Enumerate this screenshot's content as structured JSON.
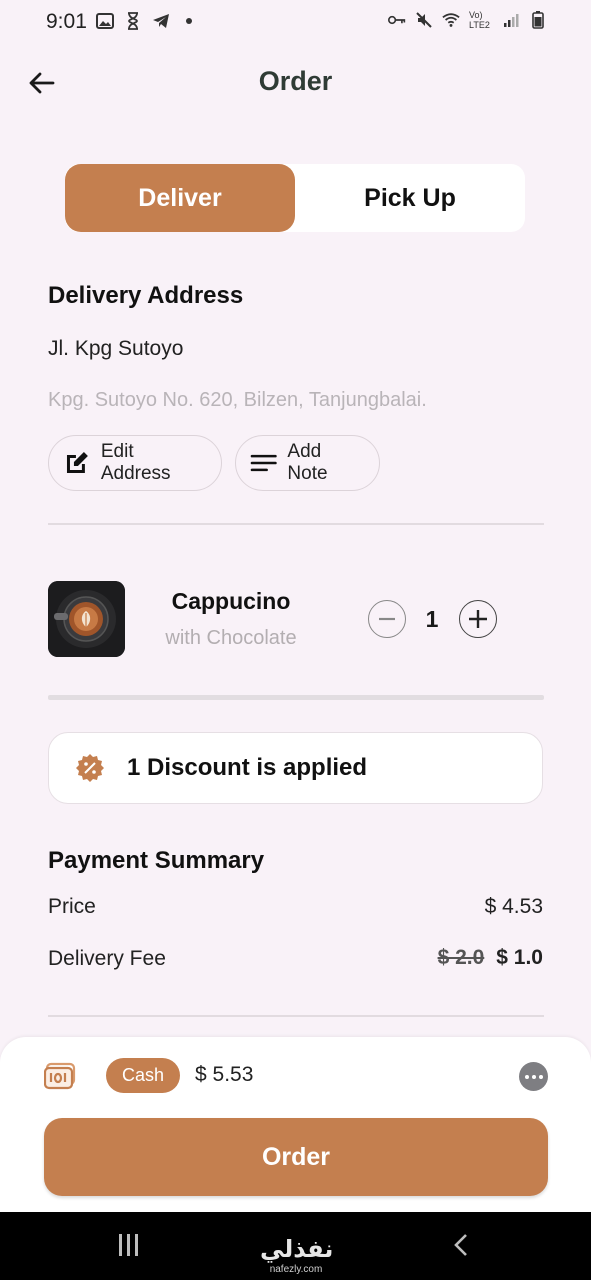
{
  "status_bar": {
    "time": "9:01",
    "network_label": "Vo) LTE2"
  },
  "header": {
    "title": "Order",
    "back_icon": "arrow-left-icon"
  },
  "toggle": {
    "deliver_label": "Deliver",
    "pickup_label": "Pick Up",
    "selected": "Deliver"
  },
  "address": {
    "title": "Delivery Address",
    "line1": "Jl. Kpg Sutoyo",
    "line2": "Kpg. Sutoyo No. 620, Bilzen, Tanjungbalai.",
    "edit_label": "Edit Address",
    "note_label": "Add Note"
  },
  "product": {
    "name": "Cappucino",
    "variant": "with Chocolate",
    "quantity": "1"
  },
  "discount": {
    "text": "1 Discount is applied"
  },
  "payment": {
    "title": "Payment Summary",
    "price_label": "Price",
    "price_value": "$ 4.53",
    "fee_label": "Delivery Fee",
    "fee_old": "$ 2.0",
    "fee_new": "$ 1.0"
  },
  "checkout": {
    "method": "Cash",
    "total": "$ 5.53",
    "order_label": "Order"
  },
  "watermark": {
    "logo": "نفذلي",
    "url": "nafezly.com"
  },
  "colors": {
    "accent": "#c47f4f",
    "background": "#f9f2f8",
    "title": "#2f3b35"
  }
}
